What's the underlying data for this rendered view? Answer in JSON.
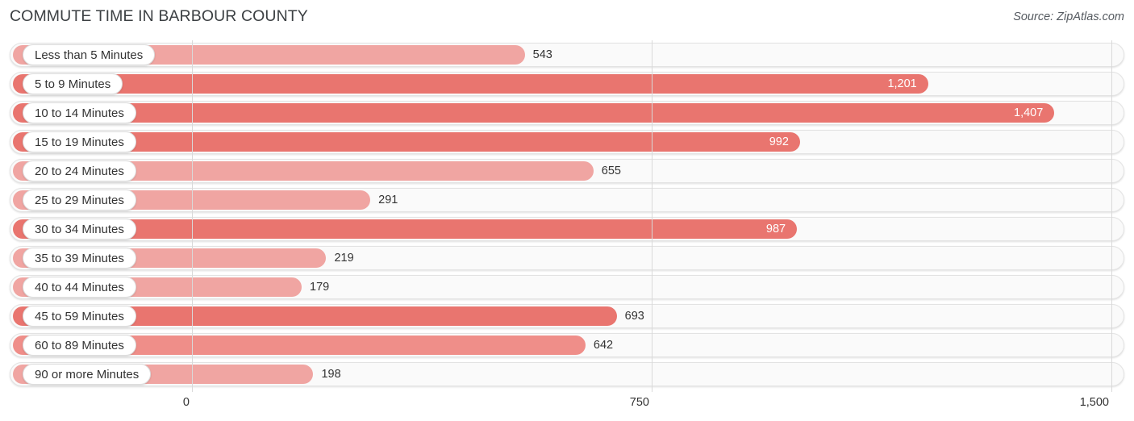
{
  "header": {
    "title": "COMMUTE TIME IN BARBOUR COUNTY",
    "source": "Source: ZipAtlas.com"
  },
  "colors": {
    "bar_light": "#f0a5a2",
    "bar_dark": "#e9756f",
    "track_fill": "#fafafa",
    "track_border": "#e3e3e3",
    "gridline": "#d9d9d9",
    "text_dark": "#333333",
    "text_light": "#ffffff",
    "title": "#3c4043"
  },
  "chart_data": {
    "type": "bar",
    "orientation": "horizontal",
    "title": "COMMUTE TIME IN BARBOUR COUNTY",
    "xlabel": "",
    "ylabel": "",
    "xlim": [
      0,
      1500
    ],
    "grid": true,
    "legend": false,
    "source": "Source: ZipAtlas.com",
    "xticks": [
      0,
      750,
      1500
    ],
    "xtick_labels": [
      "0",
      "750",
      "1,500"
    ],
    "categories": [
      "Less than 5 Minutes",
      "5 to 9 Minutes",
      "10 to 14 Minutes",
      "15 to 19 Minutes",
      "20 to 24 Minutes",
      "25 to 29 Minutes",
      "30 to 34 Minutes",
      "35 to 39 Minutes",
      "40 to 44 Minutes",
      "45 to 59 Minutes",
      "60 to 89 Minutes",
      "90 or more Minutes"
    ],
    "values": [
      543,
      1201,
      1407,
      992,
      655,
      291,
      987,
      219,
      179,
      693,
      642,
      198
    ],
    "value_labels": [
      "543",
      "1,201",
      "1,407",
      "992",
      "655",
      "291",
      "987",
      "219",
      "179",
      "693",
      "642",
      "198"
    ],
    "bars": [
      {
        "label": "Less than 5 Minutes",
        "value": 543,
        "value_label": "543",
        "color": "#f0a5a2",
        "label_inside": false
      },
      {
        "label": "5 to 9 Minutes",
        "value": 1201,
        "value_label": "1,201",
        "color": "#e9756f",
        "label_inside": true
      },
      {
        "label": "10 to 14 Minutes",
        "value": 1407,
        "value_label": "1,407",
        "color": "#e9756f",
        "label_inside": true
      },
      {
        "label": "15 to 19 Minutes",
        "value": 992,
        "value_label": "992",
        "color": "#e9756f",
        "label_inside": true
      },
      {
        "label": "20 to 24 Minutes",
        "value": 655,
        "value_label": "655",
        "color": "#f0a5a2",
        "label_inside": false
      },
      {
        "label": "25 to 29 Minutes",
        "value": 291,
        "value_label": "291",
        "color": "#f0a5a2",
        "label_inside": false
      },
      {
        "label": "30 to 34 Minutes",
        "value": 987,
        "value_label": "987",
        "color": "#e9756f",
        "label_inside": true
      },
      {
        "label": "35 to 39 Minutes",
        "value": 219,
        "value_label": "219",
        "color": "#f0a5a2",
        "label_inside": false
      },
      {
        "label": "40 to 44 Minutes",
        "value": 179,
        "value_label": "179",
        "color": "#f0a5a2",
        "label_inside": false
      },
      {
        "label": "45 to 59 Minutes",
        "value": 693,
        "value_label": "693",
        "color": "#e9756f",
        "label_inside": false
      },
      {
        "label": "60 to 89 Minutes",
        "value": 642,
        "value_label": "642",
        "color": "#ef8e89",
        "label_inside": false
      },
      {
        "label": "90 or more Minutes",
        "value": 198,
        "value_label": "198",
        "color": "#f0a5a2",
        "label_inside": false
      }
    ]
  }
}
